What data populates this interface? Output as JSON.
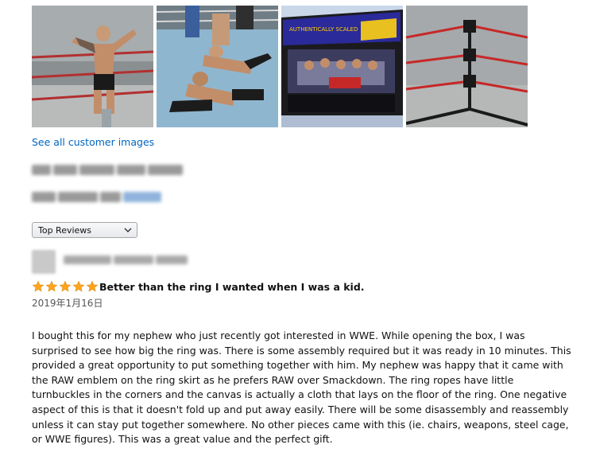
{
  "images": {
    "thumbnails": [
      {
        "alt": "wrestler-figure-flexing"
      },
      {
        "alt": "figures-in-ring"
      },
      {
        "alt": "product-box"
      },
      {
        "alt": "ring-turnbuckle-corner"
      }
    ],
    "see_all_label": "See all customer images"
  },
  "sort": {
    "selected": "Top Reviews"
  },
  "review": {
    "rating": 5,
    "title": "Better than the ring I wanted when I was a kid.",
    "date": "2019年1月16日",
    "body": "I bought this for my nephew who just recently got interested in WWE. While opening the box, I was surprised to see how big the ring was. There is some assembly required but it was ready in 10 minutes. This provided a great opportunity to put something together with him. My nephew was happy that it came with the RAW emblem on the ring skirt as he prefers RAW over Smackdown. The ring ropes have little turnbuckles in the corners and the canvas is actually a cloth that lays on the floor of the ring. One negative aspect of this is that it doesn't fold up and put away easily. There will be some disassembly and reassembly unless it can stay put together somewhere. No other pieces came with this (ie. chairs, weapons, steel cage, or WWE figures). This was a great value and the perfect gift."
  },
  "colors": {
    "link": "#0066c0",
    "star": "#ffa41c",
    "text": "#111111",
    "muted": "#555555"
  }
}
